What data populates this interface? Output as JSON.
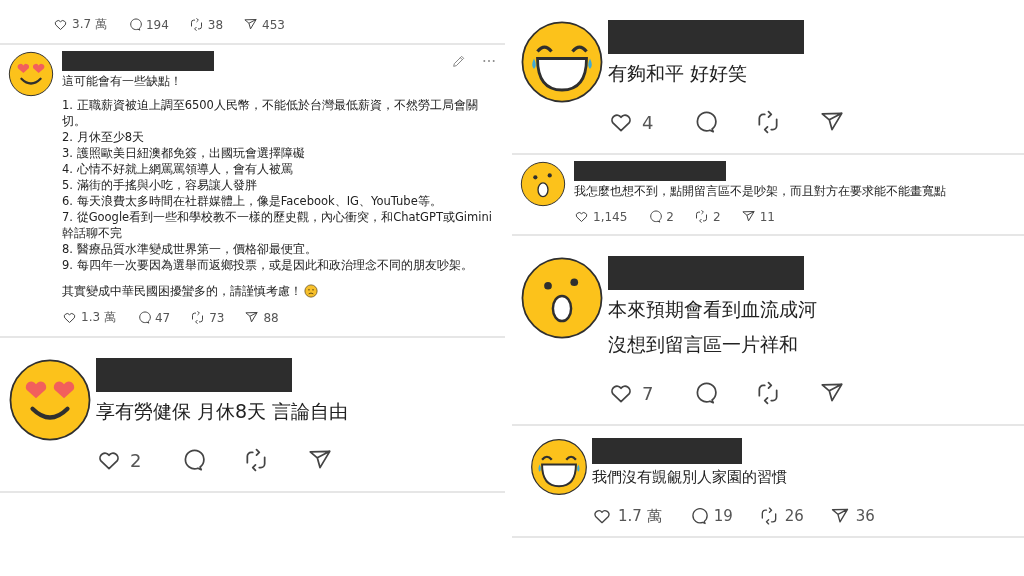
{
  "columns": [
    {
      "posts": [
        {
          "kind": "small",
          "actions": {
            "likes": "3.7 萬",
            "replies": "194",
            "reposts": "38",
            "shares": "453"
          }
        },
        {
          "kind": "small",
          "avatar": {
            "kind": "heart_eyes"
          },
          "tools": true,
          "paragraphs": [
            "這可能會有一些缺點！"
          ],
          "list": [
            "1. 正職薪資被迫上調至6500人民幣，不能低於台灣最低薪資，不然勞工局會關切。",
            "2. 月休至少8天",
            "3. 護照歐美日紐澳都免簽，出國玩會選擇障礙",
            "4. 心情不好就上網罵罵領導人，會有人被罵",
            "5. 滿街的手搖與小吃，容易讓人發胖",
            "6. 每天浪費太多時間在社群媒體上，像是Facebook、IG、YouTube等。",
            "7. 從Google看到一些和學校教不一樣的歷史觀，內心衝突，和ChatGPT或Gimini幹話聊不完",
            "8. 醫療品質水準變成世界第一，價格卻最便宜。",
            "9. 每四年一次要因為選舉而返鄉投票，或是因此和政治理念不同的朋友吵架。"
          ],
          "closing": {
            "text": "其實變成中華民國困擾蠻多的，請謹慎考慮！",
            "emoji": {
              "kind": "frown"
            }
          },
          "actions": {
            "likes": "1.3 萬",
            "replies": "47",
            "reposts": "73",
            "shares": "88"
          }
        },
        {
          "kind": "large",
          "avatar": {
            "kind": "heart_eyes"
          },
          "paragraphs": [
            "享有勞健保 月休8天 言論自由"
          ],
          "actions": {
            "likes": "2"
          }
        }
      ]
    },
    {
      "posts": [
        {
          "kind": "large",
          "avatar": {
            "kind": "laughing"
          },
          "paragraphs": [
            "有夠和平 好好笑"
          ],
          "actions": {
            "likes": "4"
          }
        },
        {
          "kind": "small",
          "avatar": {
            "kind": "surprised"
          },
          "paragraphs": [
            "我怎麼也想不到，點開留言區不是吵架，而且對方在要求能不能畫寬點"
          ],
          "actions": {
            "likes": "1,145",
            "replies": "2",
            "reposts": "2",
            "shares": "11"
          }
        },
        {
          "kind": "large",
          "avatar": {
            "kind": "surprised"
          },
          "paragraphs": [
            "本來預期會看到血流成河",
            "沒想到留言區一片祥和"
          ],
          "actions": {
            "likes": "7"
          }
        },
        {
          "kind": "medium",
          "avatar": {
            "kind": "laughing"
          },
          "paragraphs": [
            "我們沒有覬覦別人家園的習慣"
          ],
          "actions": {
            "likes": "1.7 萬",
            "replies": "19",
            "reposts": "26",
            "shares": "36"
          }
        }
      ]
    }
  ]
}
